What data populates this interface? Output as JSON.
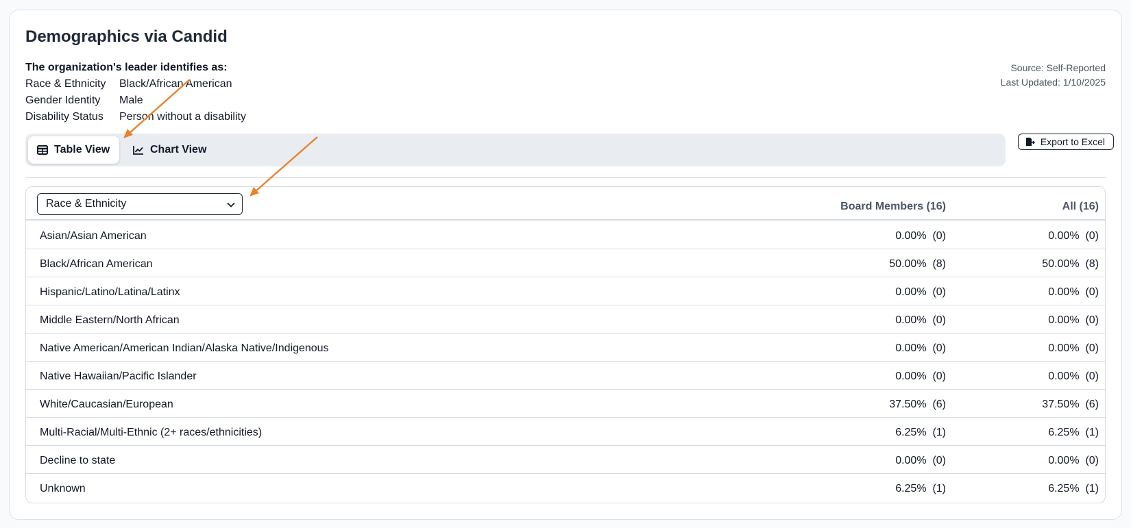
{
  "title": "Demographics via Candid",
  "leader": {
    "heading": "The organization's leader identifies as:",
    "rows": [
      {
        "label": "Race & Ethnicity",
        "value": "Black/African American"
      },
      {
        "label": "Gender Identity",
        "value": "Male"
      },
      {
        "label": "Disability Status",
        "value": "Person without a disability"
      }
    ]
  },
  "source": {
    "line1": "Source: Self-Reported",
    "line2": "Last Updated: 1/10/2025"
  },
  "tabs": {
    "table_label": "Table View",
    "chart_label": "Chart View",
    "active": "table"
  },
  "export": {
    "label": "Export to Excel"
  },
  "table": {
    "select_value": "Race & Ethnicity",
    "columns": [
      "Board Members (16)",
      "All (16)"
    ],
    "rows": [
      {
        "label": "Asian/Asian American",
        "board": "0.00%  (0)",
        "all": "0.00%  (0)"
      },
      {
        "label": "Black/African American",
        "board": "50.00%  (8)",
        "all": "50.00%  (8)"
      },
      {
        "label": "Hispanic/Latino/Latina/Latinx",
        "board": "0.00%  (0)",
        "all": "0.00%  (0)"
      },
      {
        "label": "Middle Eastern/North African",
        "board": "0.00%  (0)",
        "all": "0.00%  (0)"
      },
      {
        "label": "Native American/American Indian/Alaska Native/Indigenous",
        "board": "0.00%  (0)",
        "all": "0.00%  (0)"
      },
      {
        "label": "Native Hawaiian/Pacific Islander",
        "board": "0.00%  (0)",
        "all": "0.00%  (0)"
      },
      {
        "label": "White/Caucasian/European",
        "board": "37.50%  (6)",
        "all": "37.50%  (6)"
      },
      {
        "label": "Multi-Racial/Multi-Ethnic (2+ races/ethnicities)",
        "board": "6.25%  (1)",
        "all": "6.25%  (1)"
      },
      {
        "label": "Decline to state",
        "board": "0.00%  (0)",
        "all": "0.00%  (0)"
      },
      {
        "label": "Unknown",
        "board": "6.25%  (1)",
        "all": "6.25%  (1)"
      }
    ]
  },
  "colors": {
    "annotation_arrow": "#e8832a",
    "tabbar_bg": "#e9edf2",
    "border": "#d6dbe1"
  }
}
